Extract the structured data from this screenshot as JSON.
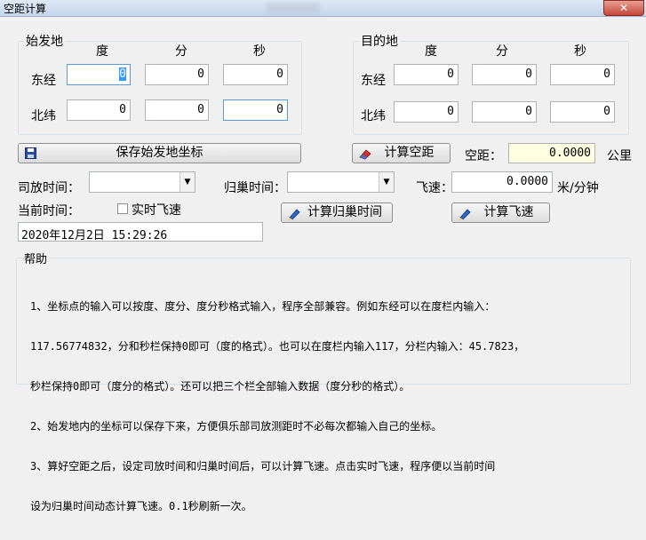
{
  "window": {
    "title": "空距计算",
    "close_label": "✕"
  },
  "headers": {
    "deg": "度",
    "min": "分",
    "sec": "秒"
  },
  "origin": {
    "title": "始发地",
    "lon_label": "东经",
    "lat_label": "北纬",
    "lon": {
      "deg": "0",
      "min": "0",
      "sec": "0"
    },
    "lat": {
      "deg": "0",
      "min": "0",
      "sec": "0"
    }
  },
  "destination": {
    "title": "目的地",
    "lon_label": "东经",
    "lat_label": "北纬",
    "lon": {
      "deg": "0",
      "min": "0",
      "sec": "0"
    },
    "lat": {
      "deg": "0",
      "min": "0",
      "sec": "0"
    }
  },
  "buttons": {
    "save_origin": "保存始发地坐标",
    "calc_distance": "计算空距",
    "calc_return_time": "计算归巢时间",
    "calc_speed": "计算飞速"
  },
  "distance": {
    "label": "空距：",
    "value": "0.0000",
    "unit": "公里"
  },
  "release_time": {
    "label": "司放时间：",
    "value": ""
  },
  "return_time": {
    "label": "归巢时间：",
    "value": ""
  },
  "speed": {
    "label": "飞速：",
    "value": "0.0000",
    "unit": "米/分钟"
  },
  "current_time": {
    "label": "当前时间：",
    "value": "2020年12月2日 15:29:26"
  },
  "realtime_speed": {
    "label": "实时飞速",
    "checked": false
  },
  "help": {
    "title": "帮助",
    "lines": [
      "1、坐标点的输入可以按度、度分、度分秒格式输入，程序全部兼容。例如东经可以在度栏内输入：",
      "117.56774832，分和秒栏保持0即可（度的格式）。也可以在度栏内输入117，分栏内输入：45.7823，",
      "秒栏保持0即可（度分的格式）。还可以把三个栏全部输入数据（度分秒的格式）。",
      "2、始发地内的坐标可以保存下来，方便俱乐部司放测距时不必每次都输入自己的坐标。",
      "3、算好空距之后，设定司放时间和归巢时间后，可以计算飞速。点击实时飞速，程序便以当前时间",
      "设为归巢时间动态计算飞速。0.1秒刷新一次。"
    ]
  },
  "colors": {
    "distance_bg": "#ffffe1",
    "selection": "#3399ff"
  }
}
